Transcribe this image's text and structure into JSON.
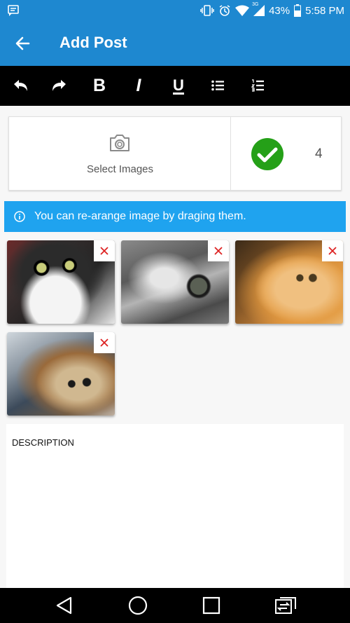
{
  "status_bar": {
    "battery": "43%",
    "time": "5:58 PM",
    "network": "3G",
    "icons": [
      "notification-icon",
      "vibrate-icon",
      "alarm-icon",
      "wifi-icon",
      "signal-icon",
      "battery-icon"
    ]
  },
  "app_bar": {
    "title": "Add Post",
    "back_icon": "arrow-back-icon",
    "color": "#1e88d0"
  },
  "toolbar": {
    "items": [
      {
        "name": "undo",
        "icon": "undo-icon"
      },
      {
        "name": "redo",
        "icon": "redo-icon"
      },
      {
        "name": "bold",
        "label": "B"
      },
      {
        "name": "italic",
        "label": "I"
      },
      {
        "name": "underline",
        "label": "U"
      },
      {
        "name": "bullet-list",
        "icon": "bullet-list-icon"
      },
      {
        "name": "numbered-list",
        "icon": "numbered-list-icon"
      }
    ]
  },
  "image_picker": {
    "select_label": "Select Images",
    "selected_count": "4",
    "check_color": "#25a018"
  },
  "info_banner": {
    "text": "You can re-arange image by draging them.",
    "color": "#1fa3ef"
  },
  "images": [
    {
      "subject": "black and white kitten"
    },
    {
      "subject": "grey tabby kitten close-up"
    },
    {
      "subject": "orange kitten"
    },
    {
      "subject": "brown tabby kitten"
    }
  ],
  "description": {
    "label": "DESCRIPTION",
    "value": ""
  },
  "nav_bar": {
    "buttons": [
      "back-triangle-icon",
      "home-circle-icon",
      "recents-square-icon",
      "switch-app-icon"
    ]
  }
}
